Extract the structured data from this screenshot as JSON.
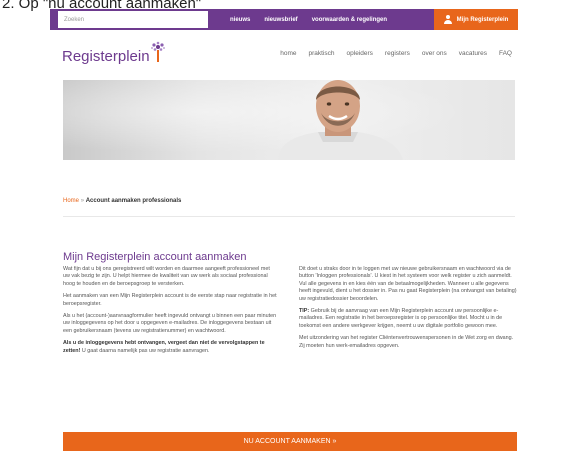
{
  "caption": "2. Op \"nu account aanmaken\"",
  "topbar": {
    "search_placeholder": "Zoeken",
    "links": [
      "nieuws",
      "nieuwsbrief",
      "voorwaarden & regelingen"
    ],
    "account_button": "Mijn Registerplein"
  },
  "header": {
    "logo_text": "Registerplein",
    "nav": [
      "home",
      "praktisch",
      "opleiders",
      "registers",
      "over ons",
      "vacatures",
      "FAQ"
    ]
  },
  "breadcrumb": {
    "home": "Home",
    "separator": "»",
    "current": "Account aanmaken professionals"
  },
  "main": {
    "title": "Mijn Registerplein account aanmaken",
    "left_paragraphs": [
      "Wat fijn dat u bij ons geregistreerd wilt worden en daarmee aangeeft professioneel met uw vak bezig te zijn. U helpt hiermee de kwaliteit van uw werk als sociaal professional hoog te houden en de beroepsgroep te versterken.",
      "Het aanmaken van een Mijn Registerplein account is de eerste stap naar registratie in het beroepsregister.",
      "Als u het (account-)aanvraagformulier heeft ingevuld ontvangt u binnen een paar minuten uw inloggegevens op het door u opgegeven e-mailadres. De inloggegevens bestaan uit een gebruikersnaam (tevens uw registratienummer) en wachtwoord."
    ],
    "left_bold": "Als u de inloggegevens hebt ontvangen, vergeet dan niet de vervolgstappen te zetten!",
    "left_bold_tail": " U gaat daarna namelijk pas uw registratie aanvragen.",
    "right_paragraph_1": "Dit doet u straks door in te loggen met uw nieuwe gebruikersnaam en wachtwoord via de button 'Inloggen professionals'. U kiest in het systeem voor welk register u zich aanmeldt. Vul alle gegevens in en kies één van de betaalmogelijkheden. Wanneer u alle gegevens heeft ingevuld, dient u het dossier in. Pas nu gaat Registerplein (na ontvangst van betaling) uw registratiedossier beoordelen.",
    "tip_label": "TIP:",
    "tip_text": " Gebruik bij de aanvraag van een Mijn Registerplein account uw persoonlijke e-mailadres. Een registratie in het beroepsregister is op persoonlijke titel. Mocht u in de toekomst een andere werkgever krijgen, neemt u uw digitale portfolio gewoon mee.",
    "right_paragraph_3": "Met uitzondering van het register Cliëntenvertrouwenspersonen in de Wet zorg en dwang. Zij moeten hun werk-emailadres opgeven."
  },
  "cta": {
    "label": "NU ACCOUNT AANMAKEN »"
  },
  "colors": {
    "purple": "#6d3a8e",
    "orange": "#e8661b"
  }
}
